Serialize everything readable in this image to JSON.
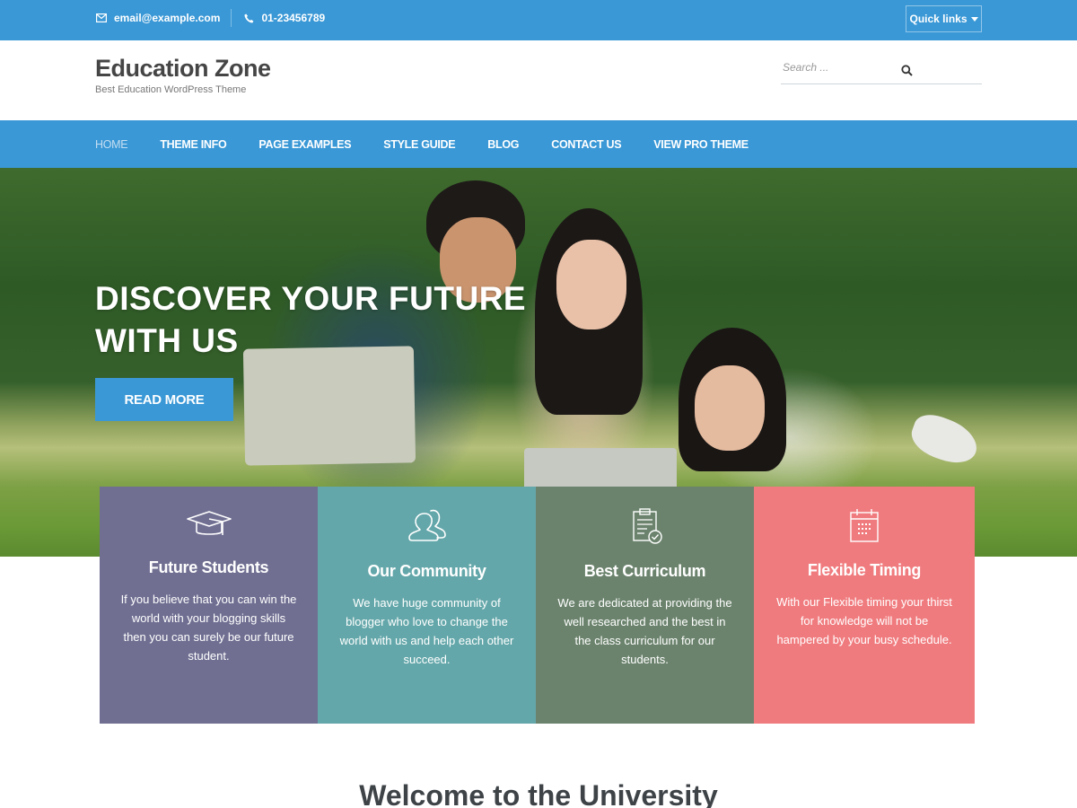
{
  "topbar": {
    "email": "email@example.com",
    "phone": "01-23456789",
    "email_icon": "envelope-icon",
    "phone_icon": "phone-icon",
    "quick_links_label": "Quick links"
  },
  "header": {
    "site_title": "Education Zone",
    "site_description": "Best Education WordPress Theme",
    "search_placeholder": "Search ...",
    "search_value": ""
  },
  "nav": {
    "items": [
      {
        "label": "HOME",
        "active": true
      },
      {
        "label": "THEME INFO",
        "active": false
      },
      {
        "label": "PAGE EXAMPLES",
        "active": false
      },
      {
        "label": "STYLE GUIDE",
        "active": false
      },
      {
        "label": "BLOG",
        "active": false
      },
      {
        "label": "CONTACT US",
        "active": false
      },
      {
        "label": "VIEW PRO THEME",
        "active": false
      }
    ]
  },
  "hero": {
    "title": "DISCOVER YOUR FUTURE WITH US",
    "button_label": "READ MORE"
  },
  "features": [
    {
      "icon": "graduation-cap-icon",
      "title": "Future Students",
      "text": "If you believe that you can win the world with your blogging skills then you can surely be our future student.",
      "color": "#706f92"
    },
    {
      "icon": "users-icon",
      "title": "Our Community",
      "text": "We have huge community of blogger who love to change the world with us and help each other succeed.",
      "color": "#64a7aa"
    },
    {
      "icon": "clipboard-check-icon",
      "title": "Best Curriculum",
      "text": "We are dedicated at providing the well researched and the best in the class curriculum for our students.",
      "color": "#6b836d"
    },
    {
      "icon": "calendar-icon",
      "title": "Flexible Timing",
      "text": "With our Flexible timing your thirst for knowledge will not be hampered by your busy schedule.",
      "color": "#f07b7e"
    }
  ],
  "welcome": {
    "title": "Welcome to the University"
  },
  "colors": {
    "brand_blue": "#3a98d6",
    "title_text": "#454545"
  }
}
